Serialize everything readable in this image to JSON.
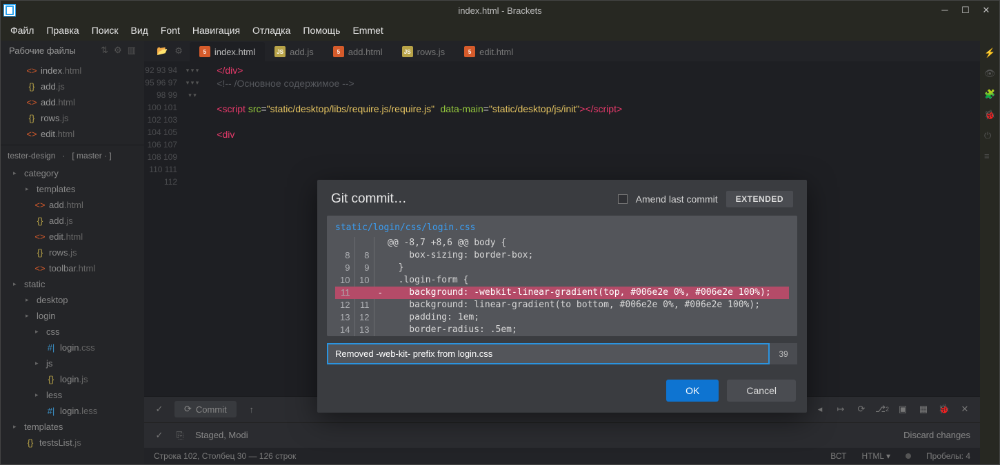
{
  "window": {
    "title": "index.html - Brackets"
  },
  "menus": [
    "Файл",
    "Правка",
    "Поиск",
    "Вид",
    "Font",
    "Навигация",
    "Отладка",
    "Помощь",
    "Emmet"
  ],
  "workingFiles": {
    "header": "Рабочие файлы",
    "items": [
      {
        "name": "index",
        "ext": ".html",
        "type": "html"
      },
      {
        "name": "add",
        "ext": ".js",
        "type": "js"
      },
      {
        "name": "add",
        "ext": ".html",
        "type": "html"
      },
      {
        "name": "rows",
        "ext": ".js",
        "type": "js"
      },
      {
        "name": "edit",
        "ext": ".html",
        "type": "html"
      }
    ]
  },
  "git": {
    "project": "tester-design",
    "branch": "master"
  },
  "tree": [
    {
      "label": "category",
      "lvl": 1,
      "type": "folder"
    },
    {
      "label": "templates",
      "lvl": 2,
      "type": "folder"
    },
    {
      "label": "add",
      "ext": ".html",
      "lvl": 3,
      "type": "html"
    },
    {
      "label": "add",
      "ext": ".js",
      "lvl": 3,
      "type": "js"
    },
    {
      "label": "edit",
      "ext": ".html",
      "lvl": 3,
      "type": "html"
    },
    {
      "label": "rows",
      "ext": ".js",
      "lvl": 3,
      "type": "js"
    },
    {
      "label": "toolbar",
      "ext": ".html",
      "lvl": 3,
      "type": "html"
    },
    {
      "label": "static",
      "lvl": 1,
      "type": "folder"
    },
    {
      "label": "desktop",
      "lvl": 2,
      "type": "folder"
    },
    {
      "label": "login",
      "lvl": 2,
      "type": "folder"
    },
    {
      "label": "css",
      "lvl": 3,
      "type": "folder"
    },
    {
      "label": "login",
      "ext": ".css",
      "lvl": 4,
      "type": "css"
    },
    {
      "label": "js",
      "lvl": 3,
      "type": "folder"
    },
    {
      "label": "login",
      "ext": ".js",
      "lvl": 4,
      "type": "js"
    },
    {
      "label": "less",
      "lvl": 3,
      "type": "folder"
    },
    {
      "label": "login",
      "ext": ".less",
      "lvl": 4,
      "type": "less"
    },
    {
      "label": "templates",
      "lvl": 1,
      "type": "folder"
    },
    {
      "label": "testsList",
      "ext": ".js",
      "lvl": 2,
      "type": "js"
    }
  ],
  "tabs": [
    {
      "label": "index.html",
      "type": "html",
      "active": true
    },
    {
      "label": "add.js",
      "type": "js"
    },
    {
      "label": "add.html",
      "type": "html"
    },
    {
      "label": "rows.js",
      "type": "js"
    },
    {
      "label": "edit.html",
      "type": "html"
    }
  ],
  "gutter": {
    "start": 92,
    "end": 112,
    "folds": [
      97,
      98,
      99,
      100,
      106,
      107,
      108,
      109
    ]
  },
  "code": {
    "l92": "</div>",
    "l93": "<!-- /Основное содержимое -->",
    "l95": {
      "p1": "<script ",
      "p2": "src",
      "p3": "=",
      "p4": "\"static/desktop/libs/require.js/require.js\"",
      "p5": " data-main",
      "p6": "=",
      "p7": "\"static/desktop/js/init\"",
      "p8": "></scr",
      "p9": "ipt>"
    },
    "l97": "<div",
    "l393": "/>"
  },
  "panel": {
    "commit": "Commit",
    "staged": "Staged, Modi",
    "discard": "Discard changes",
    "badge": "2"
  },
  "status": {
    "pos": "Строка 102, Столбец 30 — 126 строк",
    "ins": "ВСТ",
    "lang": "HTML",
    "spaces": "Пробелы: 4"
  },
  "dialog": {
    "title": "Git commit…",
    "amend": "Amend last commit",
    "extended": "EXTENDED",
    "file": "static/login/css/login.css",
    "hunk": "@@ -8,7 +8,6 @@ body {",
    "rows": [
      {
        "a": "8",
        "b": "8",
        "s": "",
        "c": "    box-sizing: border-box;"
      },
      {
        "a": "9",
        "b": "9",
        "s": "",
        "c": "  }"
      },
      {
        "a": "10",
        "b": "10",
        "s": "",
        "c": "  .login-form {"
      },
      {
        "a": "11",
        "b": "",
        "s": "-",
        "c": "    background: -webkit-linear-gradient(top, #006e2e 0%, #006e2e 100%);",
        "removed": true
      },
      {
        "a": "12",
        "b": "11",
        "s": "",
        "c": "    background: linear-gradient(to bottom, #006e2e 0%, #006e2e 100%);"
      },
      {
        "a": "13",
        "b": "12",
        "s": "",
        "c": "    padding: 1em;"
      },
      {
        "a": "14",
        "b": "13",
        "s": "",
        "c": "    border-radius: .5em;"
      }
    ],
    "message": "Removed -web-kit- prefix from login.css",
    "count": "39",
    "ok": "OK",
    "cancel": "Cancel"
  }
}
